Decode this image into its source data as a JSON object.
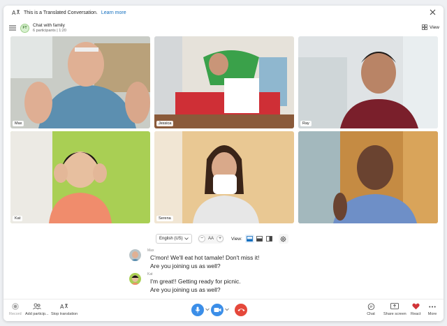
{
  "banner": {
    "text": "This is a Translated Conversation.",
    "learn_more": "Learn more"
  },
  "header": {
    "avatar_initials": "FT",
    "chat_name": "Chat with family",
    "participants": "6 participants | 1:20",
    "view_label": "View"
  },
  "participants": [
    {
      "name": "Max"
    },
    {
      "name": "Jessica"
    },
    {
      "name": "Ray"
    },
    {
      "name": "Kat"
    },
    {
      "name": "Serena"
    },
    {
      "name": ""
    }
  ],
  "controls": {
    "language": "English (US)",
    "minus": "−",
    "text_size": "AA",
    "plus": "+",
    "view_label": "View:"
  },
  "messages": [
    {
      "sender": "Max",
      "lines": [
        "C'mon! We'll eat hot tamale! Don't miss it!",
        "Are you joining us as well?"
      ]
    },
    {
      "sender": "Kat",
      "lines": [
        "I'm great!! Getting ready for picnic.",
        "Are you joining us as well?"
      ]
    }
  ],
  "bottombar": {
    "record": "Record",
    "add_participants": "Add particip...",
    "stop_translation": "Stop translation",
    "chat": "Chat",
    "share_screen": "Share screen",
    "react": "React",
    "more": "More"
  },
  "colors": {
    "accent": "#0f6cbd",
    "call_blue": "#3b8ee8",
    "end_red": "#e5483b",
    "react_red": "#d13438"
  }
}
